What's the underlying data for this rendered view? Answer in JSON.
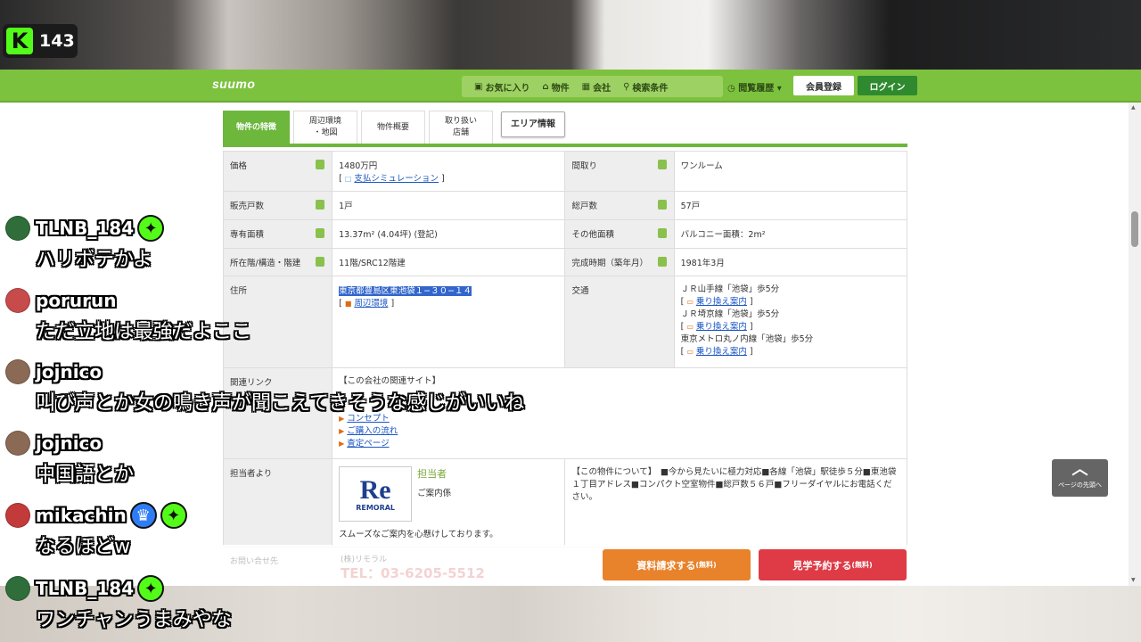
{
  "stream": {
    "viewer_count": "143",
    "platform_logo": "K"
  },
  "header": {
    "logo": "suumo",
    "nav": [
      {
        "icon": "heart-folder-icon",
        "label": "お気に入り"
      },
      {
        "icon": "house-icon",
        "label": "物件"
      },
      {
        "icon": "building-icon",
        "label": "会社"
      },
      {
        "icon": "search-icon",
        "label": "検索条件"
      }
    ],
    "history_label": "閲覧履歴 ▾",
    "register_label": "会員登録",
    "login_label": "ログイン"
  },
  "tabs": {
    "features": "物件の特徴",
    "surroundings_l1": "周辺環境",
    "surroundings_l2": "・地図",
    "overview": "物件概要",
    "store_l1": "取り扱い",
    "store_l2": "店舗",
    "area": "エリア情報"
  },
  "spec": {
    "price_label": "価格",
    "price": "1480万円",
    "price_link": "支払シミュレーション",
    "layout_label": "間取り",
    "layout": "ワンルーム",
    "units_sale_label": "販売戸数",
    "units_sale": "1戸",
    "units_total_label": "総戸数",
    "units_total": "57戸",
    "area_label": "専有面積",
    "area": "13.37m² (4.04坪) (登記)",
    "other_area_label": "その他面積",
    "other_area": "バルコニー面積：2m²",
    "floor_label": "所在階/構造・階建",
    "floor": "11階/SRC12階建",
    "built_label": "完成時期（築年月）",
    "built": "1981年3月",
    "address_label": "住所",
    "address": "東京都豊島区東池袋１−３０−１４",
    "address_link": "周辺環境",
    "transport_label": "交通",
    "transport_1": "ＪＲ山手線「池袋」歩5分",
    "transport_2": "ＪＲ埼京線「池袋」歩5分",
    "transport_3": "東京メトロ丸ノ内線「池袋」歩5分",
    "transfer_link": "乗り換え案内",
    "related_label": "関連リンク",
    "related_head": "【この会社の関連サイト】",
    "related_1": "コンセプト",
    "related_2": "ご購入の流れ",
    "related_3": "査定ページ",
    "agent_label": "担当者より",
    "agent_title": "担当者",
    "agent_role": "ご案内係",
    "agent_logo_main": "Re",
    "agent_logo_sub": "REMORAL",
    "agent_msg": "スムーズなご案内を心懸けしております。",
    "about_text": "【この物件について】　■今から見たいに極力対応■各線「池袋」駅徒歩５分■東池袋１丁目アドレス■コンパクト空室物件■総戸数５６戸■フリーダイヤルにお電話ください。"
  },
  "bottom": {
    "faded_label": "お問い合せ先",
    "faded_company": "(株)リモラル",
    "faded_tel": "TEL：03-6205-5512",
    "request_label": "資料請求する",
    "request_small": "(無料)",
    "visit_label": "見学予約する",
    "visit_small": "(無料)"
  },
  "page_top": {
    "arrow": "︿",
    "label": "ページの先頭へ"
  },
  "chat": [
    {
      "user": "TLNB_184",
      "text": "ハリボテかよ",
      "avatar_color": "#2f6d3a",
      "badges": [
        "green"
      ]
    },
    {
      "user": "porurun",
      "text": "ただ立地は最強だよここ",
      "avatar_color": "#c74b4b",
      "badges": []
    },
    {
      "user": "jojnico",
      "text": "叫び声とか女の鳴き声が聞こえてきそうな感じがいいね",
      "avatar_color": "#8a6a55",
      "badges": []
    },
    {
      "user": "jojnico",
      "text": "中国語とか",
      "avatar_color": "#8a6a55",
      "badges": []
    },
    {
      "user": "mikachin",
      "text": "なるほどw",
      "avatar_color": "#c33a3a",
      "badges": [
        "blue",
        "green"
      ]
    },
    {
      "user": "TLNB_184",
      "text": "ワンチャンうまみやな",
      "avatar_color": "#2f6d3a",
      "badges": [
        "green"
      ]
    }
  ]
}
